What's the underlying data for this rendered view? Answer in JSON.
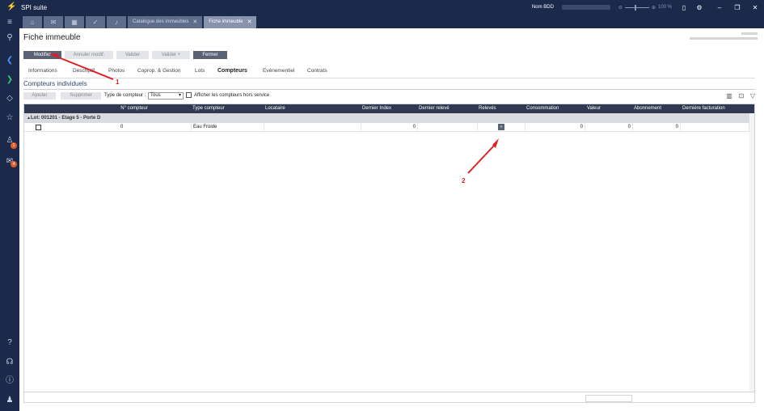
{
  "app": {
    "title": "SPI suite",
    "logo_icon": "spi-logo-icon"
  },
  "titlebar": {
    "db_label": "Nom BDD",
    "zoom": "100 %",
    "icons": [
      "minus-icon",
      "plus-icon",
      "document-icon",
      "settings-icon"
    ],
    "window": {
      "minimize": "–",
      "restore": "❐",
      "close": "✕"
    }
  },
  "leftnav": {
    "items": [
      {
        "name": "menu-icon",
        "glyph": "≡"
      },
      {
        "name": "search-icon",
        "glyph": "⚲"
      },
      {
        "name": "nav-back-icon",
        "glyph": "❮"
      },
      {
        "name": "nav-forward-icon",
        "glyph": "❯"
      },
      {
        "name": "code-icon",
        "glyph": "◇"
      },
      {
        "name": "star-icon",
        "glyph": "☆"
      },
      {
        "name": "notifications-icon",
        "glyph": "♙",
        "badge": "1"
      },
      {
        "name": "mail-icon",
        "glyph": "✉",
        "badge": "4"
      }
    ],
    "bottom": [
      {
        "name": "help-icon",
        "glyph": "?"
      },
      {
        "name": "support-icon",
        "glyph": "☊"
      },
      {
        "name": "info-icon",
        "glyph": "ⓘ"
      },
      {
        "name": "user-icon",
        "glyph": "♟"
      }
    ]
  },
  "tabs": {
    "icon_tabs": [
      {
        "name": "home-tab-icon",
        "glyph": "⌂"
      },
      {
        "name": "mail-tab-icon",
        "glyph": "✉"
      },
      {
        "name": "calendar-tab-icon",
        "glyph": "▦"
      },
      {
        "name": "check-tab-icon",
        "glyph": "✓"
      },
      {
        "name": "bell-tab-icon",
        "glyph": "♪"
      }
    ],
    "doc_tabs": [
      {
        "label": "Catalogue des immeubles",
        "active": false
      },
      {
        "label": "Fiche immeuble",
        "active": true
      }
    ],
    "close_glyph": "✕"
  },
  "page": {
    "title": "Fiche immeuble",
    "actions": {
      "modifier": "Modifier",
      "annuler": "Annuler modif.",
      "valider": "Valider",
      "valider_plus": "Valider +",
      "fermer": "Fermer"
    },
    "subtabs": [
      "Informations",
      "Descriptif",
      "Photos",
      "Coprop. & Gestion",
      "Lots",
      "Compteurs",
      "Evénementiel",
      "Contrats"
    ],
    "active_subtab": "Compteurs",
    "section_title": "Compteurs individuels",
    "toolbar": {
      "ajouter": "Ajouter",
      "supprimer": "Supprimer",
      "type_label": "Type de compteur :",
      "type_value": "Tous",
      "hors_service_label": "Afficher les compteurs hors service"
    },
    "grid": {
      "columns": [
        "N° compteur",
        "Type compteur",
        "Locataire",
        "Dernier Index",
        "Dernier relevé",
        "Relevés",
        "Consommation",
        "Valeur",
        "Abonnement",
        "Dernière facturation"
      ],
      "group_label": "Lot: 001201 - Etage 5 - Porte D",
      "group_toggle": "▲",
      "rows": [
        {
          "numero": "0",
          "type": "Eau Froide",
          "locataire": "",
          "dernier_index": "0",
          "dernier_releve": "",
          "releves_btn": "»",
          "consommation": "0",
          "valeur": "0",
          "abonnement": "0",
          "derniere_facturation": ""
        }
      ]
    }
  },
  "annotations": {
    "one": "1",
    "two": "2",
    "color": "#e02020"
  }
}
